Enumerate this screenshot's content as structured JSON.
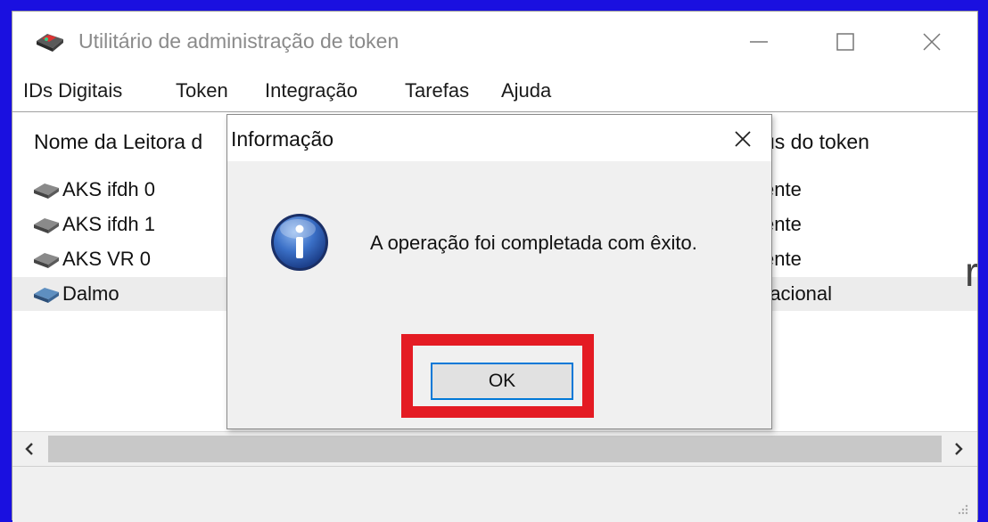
{
  "window": {
    "title": "Utilitário de administração de token",
    "app_icon": "token-utility-icon",
    "controls": [
      "minimize-icon",
      "maximize-icon",
      "close-icon"
    ]
  },
  "menu": {
    "items": [
      "IDs Digitais",
      "Token",
      "Integração",
      "Tarefas",
      "Ajuda"
    ]
  },
  "list": {
    "columns": {
      "reader_name": "Nome da Leitora d",
      "token_status": "us do token"
    },
    "readers": [
      {
        "name": "AKS ifdh 0",
        "status": "ente",
        "icon": "reader-gray-icon"
      },
      {
        "name": "AKS ifdh 1",
        "status": "ente",
        "icon": "reader-gray-icon"
      },
      {
        "name": "AKS VR 0",
        "status": "ente",
        "icon": "reader-gray-icon"
      },
      {
        "name": "Dalmo",
        "status": "racional",
        "icon": "reader-blue-icon",
        "selected": true
      }
    ],
    "background_fragment": "r"
  },
  "dialog": {
    "title": "Informação",
    "message": "A operação foi completada com êxito.",
    "icon": "info-icon",
    "ok_label": "OK"
  },
  "colors": {
    "desktop_background": "#1a10e0",
    "highlight": "#e41b23",
    "focus_border": "#0078d7"
  }
}
